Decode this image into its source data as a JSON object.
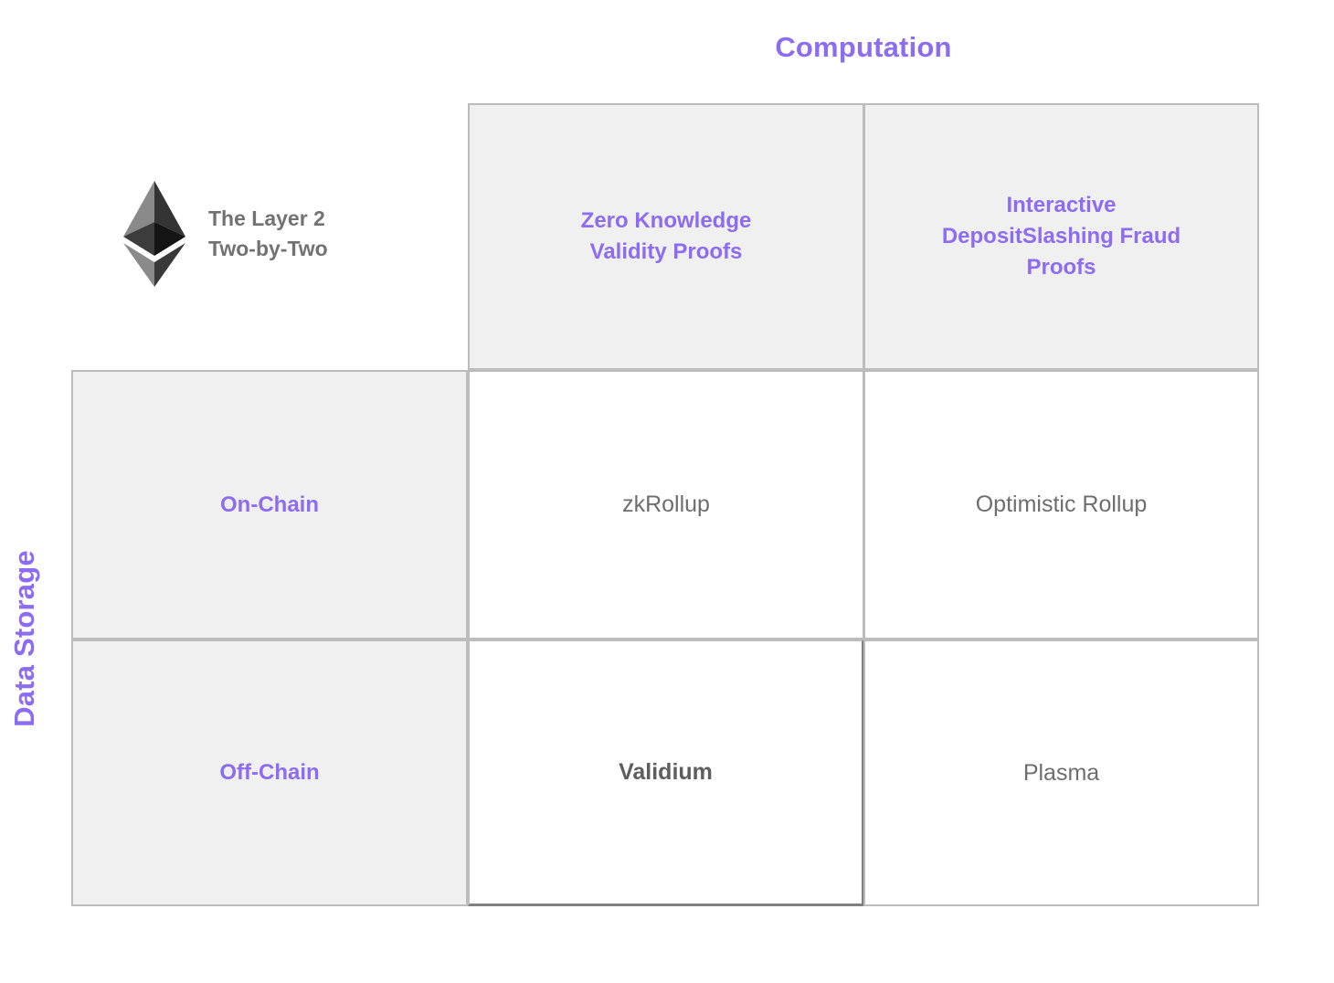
{
  "axes": {
    "top_title": "Computation",
    "left_title": "Data Storage"
  },
  "brand": {
    "logo_icon": "ethereum-logo-icon",
    "caption": "The Layer 2\nTwo-by-Two"
  },
  "colors": {
    "accent_purple": "#8c6cf0",
    "grid_line": "#bcbcbc",
    "highlight_border": "#808080",
    "shaded_cell": "#f0f0f0",
    "value_text": "#6e6e6e",
    "caption_text": "#727272"
  },
  "matrix": {
    "column_headers": [
      "Zero Knowledge\nValidity Proofs",
      "Interactive\nDepositSlashing Fraud\nProofs"
    ],
    "row_headers": [
      "On-Chain",
      "Off-Chain"
    ],
    "rows": [
      {
        "label": "On-Chain",
        "cells": [
          {
            "label": "zkRollup",
            "highlighted": false
          },
          {
            "label": "Optimistic Rollup",
            "highlighted": false
          }
        ]
      },
      {
        "label": "Off-Chain",
        "cells": [
          {
            "label": "Validium",
            "highlighted": true
          },
          {
            "label": "Plasma",
            "highlighted": false
          }
        ]
      }
    ]
  }
}
